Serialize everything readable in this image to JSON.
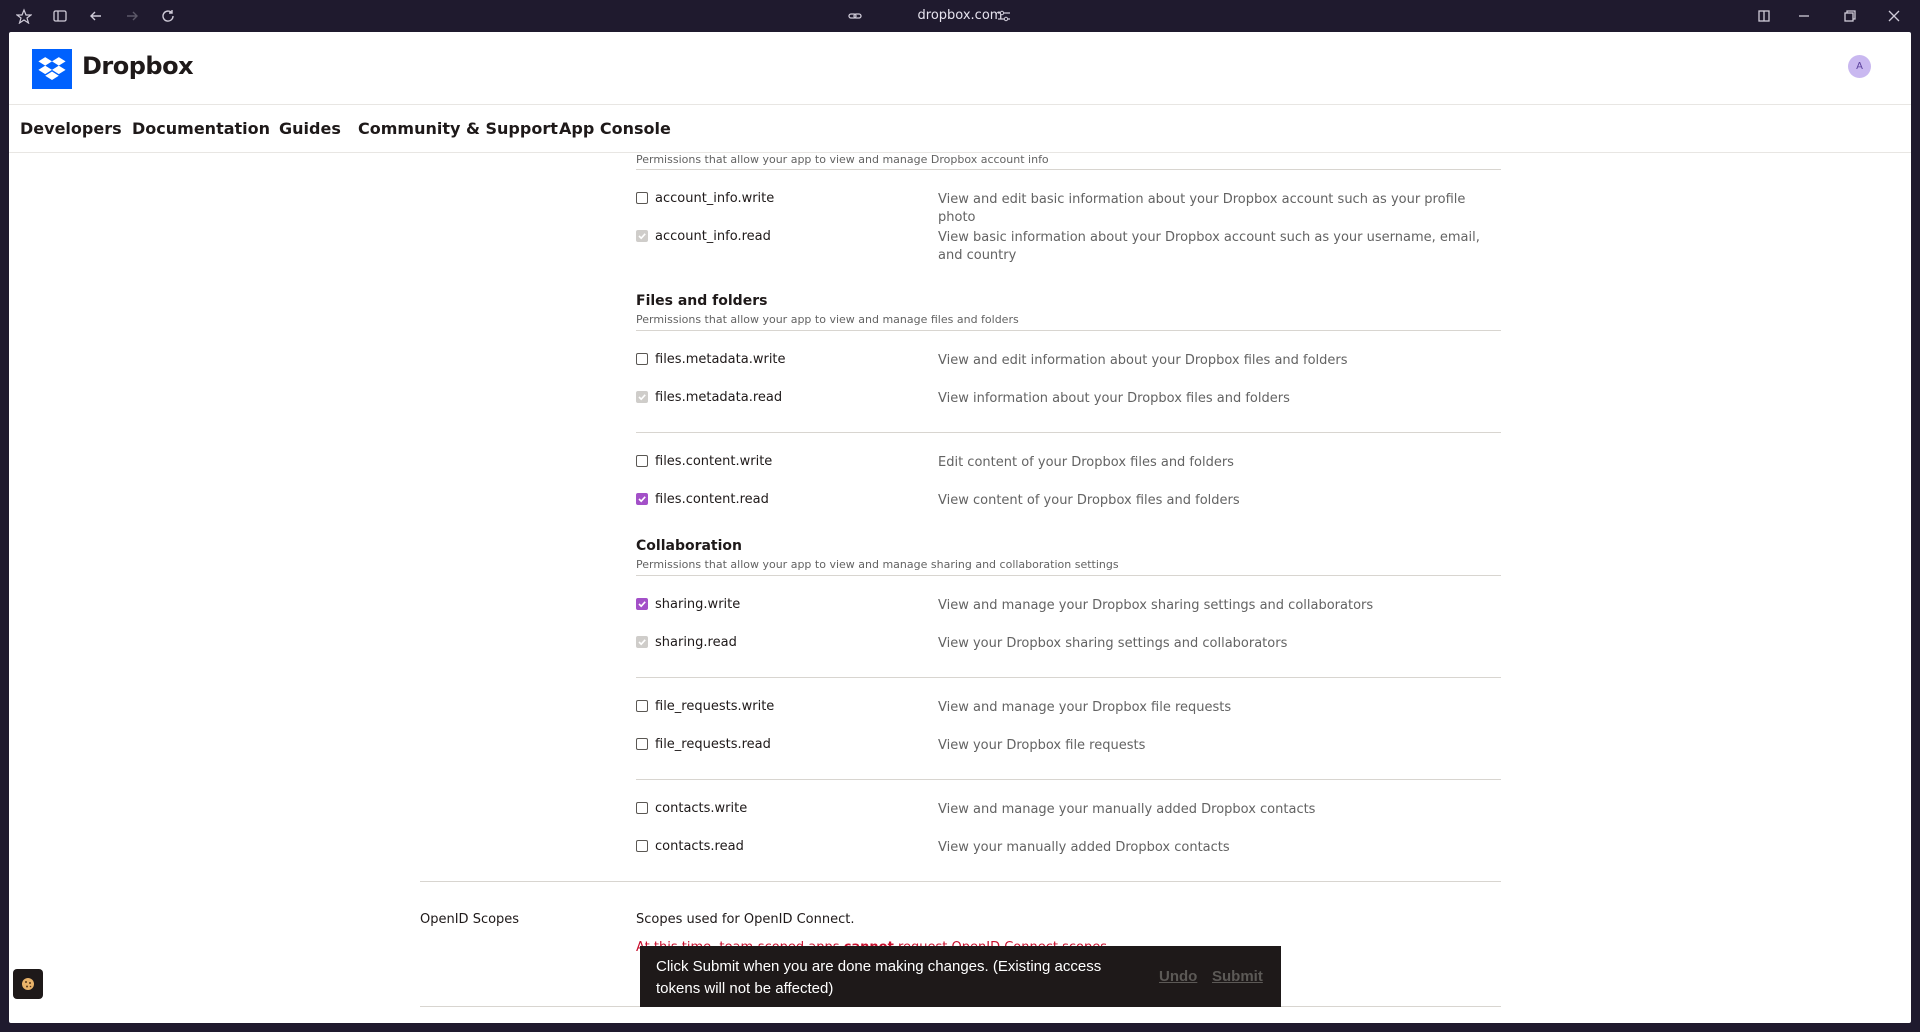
{
  "browser": {
    "url": "dropbox.com"
  },
  "header": {
    "logo_text": "Dropbox",
    "avatar_initial": "A"
  },
  "nav": {
    "items": [
      "Developers",
      "Documentation",
      "Guides",
      "Community & Support",
      "App Console"
    ]
  },
  "account_info": {
    "subtitle": "Permissions that allow your app to view and manage Dropbox account info",
    "scopes": [
      {
        "name": "account_info.write",
        "desc": "View and edit basic information about your Dropbox account such as your profile photo",
        "state": "unchecked"
      },
      {
        "name": "account_info.read",
        "desc": "View basic information about your Dropbox account such as your username, email, and country",
        "state": "disabled-checked"
      }
    ]
  },
  "files": {
    "title": "Files and folders",
    "subtitle": "Permissions that allow your app to view and manage files and folders",
    "scopes": [
      {
        "name": "files.metadata.write",
        "desc": "View and edit information about your Dropbox files and folders",
        "state": "unchecked"
      },
      {
        "name": "files.metadata.read",
        "desc": "View information about your Dropbox files and folders",
        "state": "disabled-checked"
      },
      {
        "name": "files.content.write",
        "desc": "Edit content of your Dropbox files and folders",
        "state": "unchecked"
      },
      {
        "name": "files.content.read",
        "desc": "View content of your Dropbox files and folders",
        "state": "checked"
      }
    ]
  },
  "collaboration": {
    "title": "Collaboration",
    "subtitle": "Permissions that allow your app to view and manage sharing and collaboration settings",
    "scopes": [
      {
        "name": "sharing.write",
        "desc": "View and manage your Dropbox sharing settings and collaborators",
        "state": "checked"
      },
      {
        "name": "sharing.read",
        "desc": "View your Dropbox sharing settings and collaborators",
        "state": "disabled-checked"
      },
      {
        "name": "file_requests.write",
        "desc": "View and manage your Dropbox file requests",
        "state": "unchecked"
      },
      {
        "name": "file_requests.read",
        "desc": "View your Dropbox file requests",
        "state": "unchecked"
      },
      {
        "name": "contacts.write",
        "desc": "View and manage your manually added Dropbox contacts",
        "state": "unchecked"
      },
      {
        "name": "contacts.read",
        "desc": "View your manually added Dropbox contacts",
        "state": "unchecked"
      }
    ]
  },
  "openid": {
    "label": "OpenID Scopes",
    "desc": "Scopes used for OpenID Connect.",
    "warning_pre": "At this time, team-scoped apps ",
    "warning_bold": "cannot",
    "warning_post": " request OpenID Connect scopes."
  },
  "toast": {
    "message": "Click Submit when you are done making changes. (Existing access tokens will not be affected)",
    "undo_label": "Undo",
    "submit_label": "Submit"
  },
  "colors": {
    "accent": "#a350c8",
    "brand": "#0061fe",
    "warning": "#c8102e"
  }
}
